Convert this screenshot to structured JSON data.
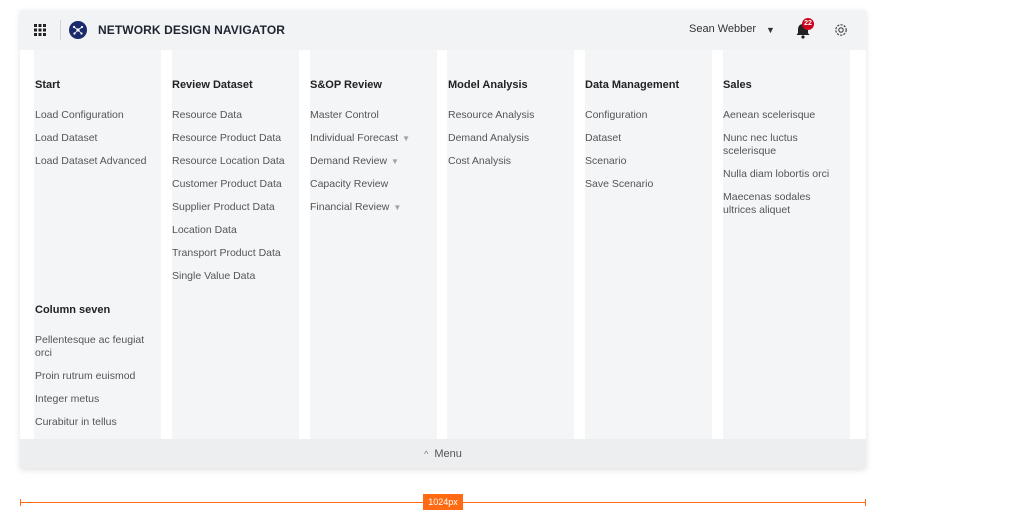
{
  "header": {
    "app_title": "NETWORK DESIGN NAVIGATOR",
    "user_name": "Sean Webber",
    "notification_count": "22"
  },
  "columns": [
    {
      "title": "Start",
      "items": [
        "Load Configuration",
        "Load Dataset",
        "Load Dataset Advanced"
      ]
    },
    {
      "title": "Review Dataset",
      "items": [
        "Resource Data",
        "Resource Product Data",
        "Resource Location Data",
        "Customer Product Data",
        "Supplier Product Data",
        "Location Data",
        "Transport Product Data",
        "Single Value Data"
      ]
    },
    {
      "title": "S&OP Review",
      "items": [
        "Master Control",
        "Individual Forecast",
        "Demand Review",
        "Capacity Review",
        "Financial Review"
      ]
    },
    {
      "title": "Model Analysis",
      "items": [
        "Resource Analysis",
        "Demand Analysis",
        "Cost Analysis"
      ]
    },
    {
      "title": "Data Management",
      "items": [
        "Configuration",
        "Dataset",
        "Scenario",
        "Save Scenario"
      ]
    },
    {
      "title": "Sales",
      "items": [
        "Aenean scelerisque",
        "Nunc nec luctus scelerisque",
        "Nulla diam lobortis orci",
        "Maecenas sodales ultrices aliquet"
      ]
    },
    {
      "title": "Column seven",
      "items": [
        "Pellentesque ac feugiat orci",
        "Proin rutrum euismod",
        "Integer metus",
        "Curabitur in tellus"
      ]
    }
  ],
  "footer": {
    "label": "Menu"
  },
  "ruler": {
    "label": "1024px"
  },
  "colors": {
    "brand": "#1b2a6b",
    "badge": "#d0021b",
    "ruler": "#ff6a13"
  }
}
